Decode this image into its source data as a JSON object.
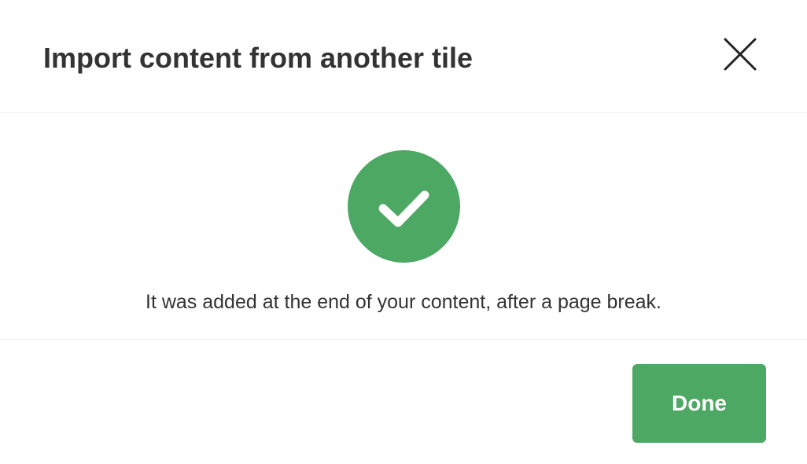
{
  "dialog": {
    "title": "Import content from another tile",
    "close_icon": "close-icon",
    "success_icon": "checkmark-icon",
    "message": "It was added at the end of your content, after a page break.",
    "done_label": "Done"
  },
  "colors": {
    "accent": "#4ca862",
    "text": "#333333",
    "divider": "#eeeeee"
  }
}
